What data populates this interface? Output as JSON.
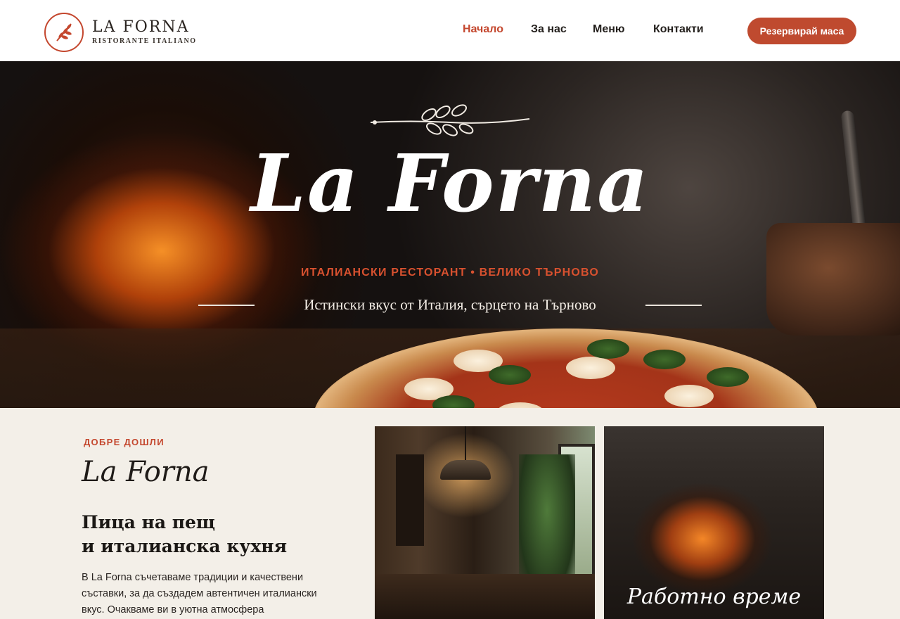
{
  "header": {
    "logo": {
      "name": "LA FORNA",
      "subtitle": "RISTORANTE ITALIANO",
      "icon": "olive-branch-icon"
    },
    "nav": [
      {
        "label": "Начало",
        "active": true
      },
      {
        "label": "За нас",
        "active": false
      },
      {
        "label": "Меню",
        "active": false
      },
      {
        "label": "Контакти",
        "active": false
      }
    ],
    "cta_label": "Резервирай маса"
  },
  "hero": {
    "title": "La Forna",
    "tagline": "ИТАЛИАНСКИ РЕСТОРАНТ • ВЕЛИКО ТЪРНОВО",
    "slogan": "Истински вкус от Италия, сърцето на Търново",
    "decor_icon": "olive-branch-icon"
  },
  "welcome": {
    "kicker": "ДОБРЕ ДОШЛИ",
    "script_title": "La Forna",
    "heading_line1": "Пица на пещ",
    "heading_line2": "и италианска кухня",
    "text": "В La Forna съчетаваме традиции и качествени съставки, за да създадем автентичен италиански вкус. Очакваме ви в уютна атмосфера"
  },
  "gallery": {
    "oven_caption": "Работно време"
  },
  "colors": {
    "accent": "#c4472e",
    "button": "#bf4a2f",
    "background": "#f3efe8",
    "header_bg": "#ffffff"
  }
}
